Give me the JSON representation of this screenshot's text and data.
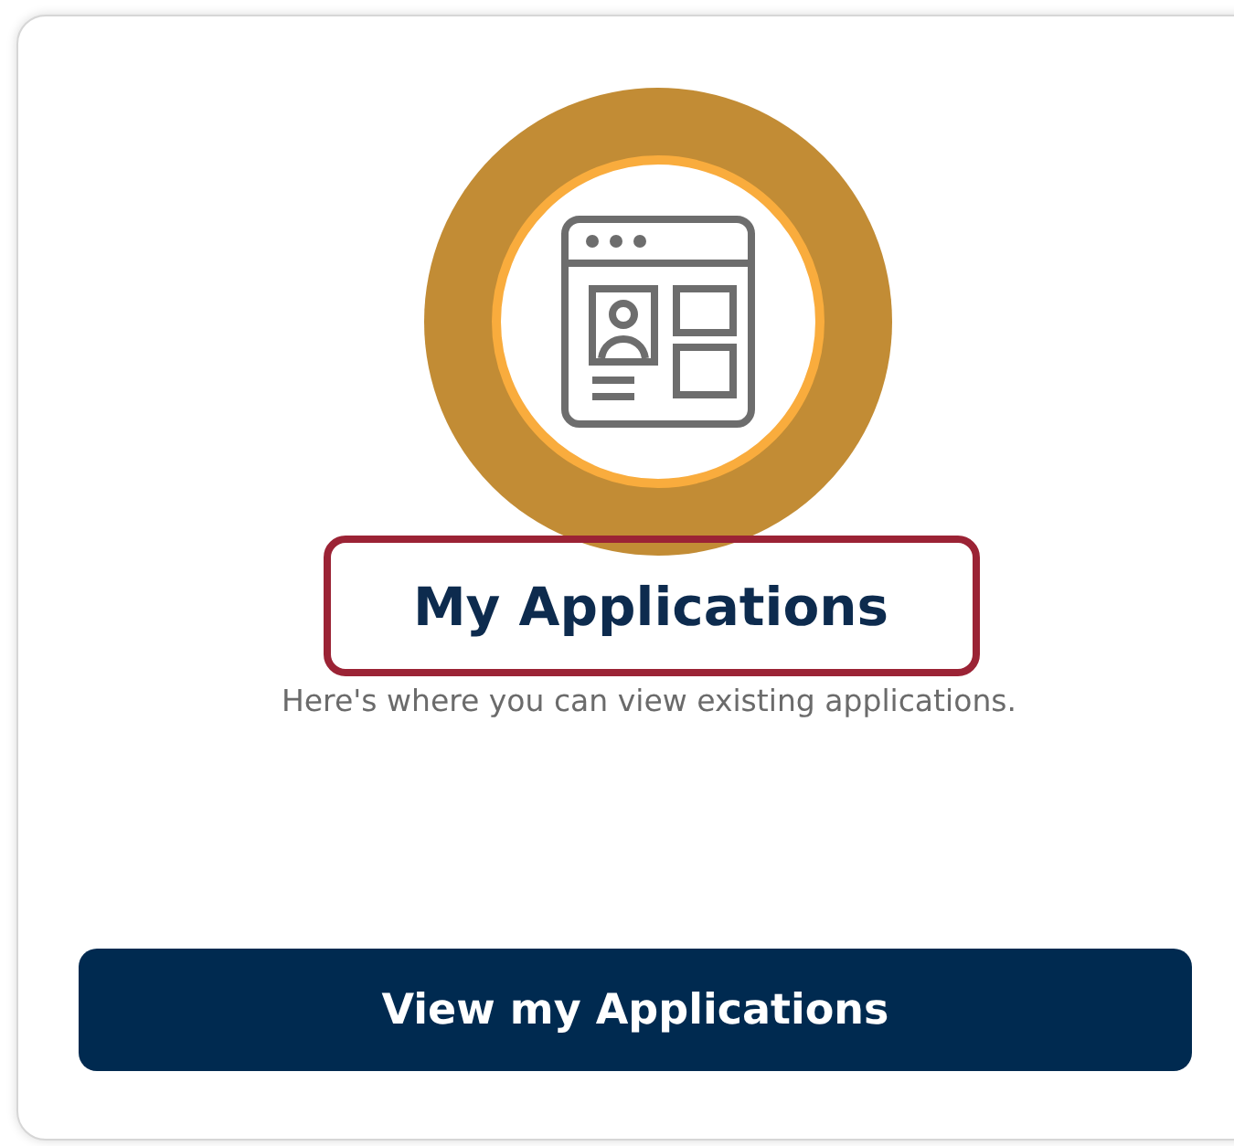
{
  "card": {
    "title": {
      "text": "My Applications",
      "highlighted": true
    },
    "description": "Here's where you can view existing applications.",
    "button": "View my Applications"
  }
}
